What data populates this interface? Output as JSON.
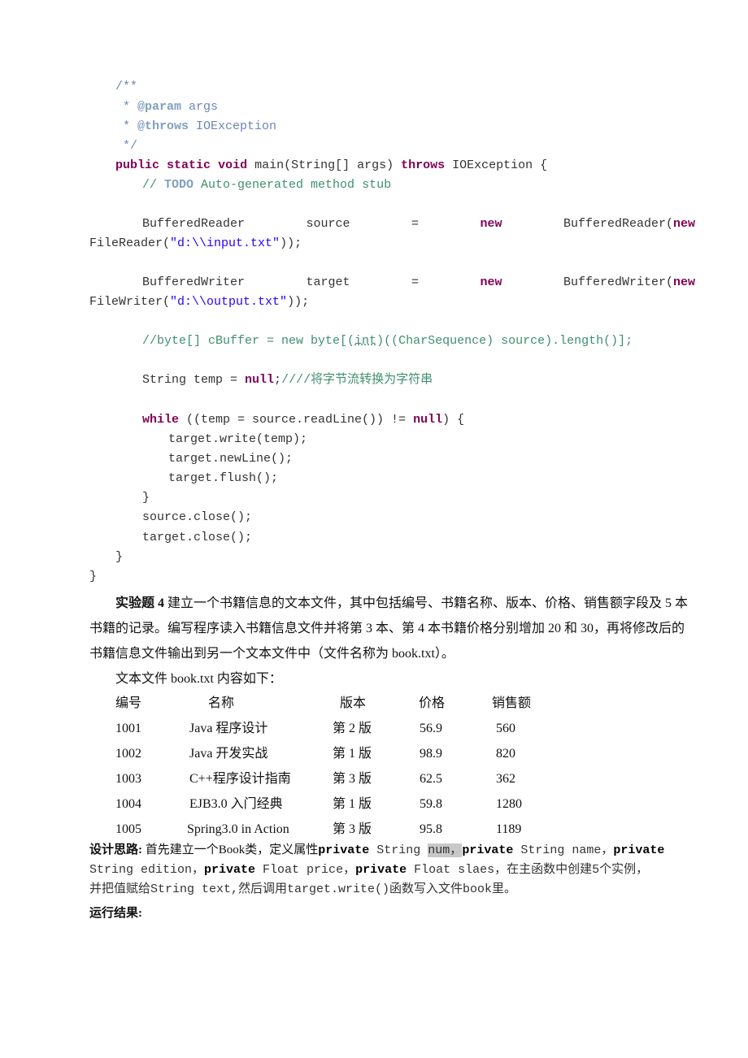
{
  "code": {
    "javadoc": {
      "open": "/**",
      "param_prefix": " * ",
      "param_tag": "@param",
      "param_text": " args",
      "throws_prefix": " * ",
      "throws_tag": "@throws",
      "throws_text": " IOException",
      "close": " */"
    },
    "main_sig": {
      "kw1": "public",
      "kw2": "static",
      "kw3": "void",
      "rest": " main(String[] args) ",
      "kw4": "throws",
      "tail": " IOException {"
    },
    "todo_comment": {
      "prefix": "// ",
      "tag": "TODO",
      "text": " Auto-generated method stub"
    },
    "reader_line": {
      "type": "BufferedReader",
      "var": "source",
      "eq": "=",
      "kw": "new",
      "ctor": "BufferedReader(",
      "kw2": "new",
      "cont_a": "FileReader(",
      "cont_str": "\"d:\\\\input.txt\"",
      "cont_b": "));"
    },
    "writer_line": {
      "type": "BufferedWriter",
      "var": "target",
      "eq": "=",
      "kw": "new",
      "ctor": "BufferedWriter(",
      "kw2": "new",
      "cont_a": "FileWriter(",
      "cont_str": "\"d:\\\\output.txt\"",
      "cont_b": "));"
    },
    "byte_comment": {
      "a": "//byte[] cBuffer = new byte[(",
      "u": "int",
      "b": ")((CharSequence) source).length()];"
    },
    "temp_line": {
      "a": "String temp = ",
      "kw": "null",
      "b": ";",
      "comment": "////将字节流转换为字符串"
    },
    "while_line": {
      "kw": "while",
      "a": " ((temp = source.readLine()) != ",
      "kw2": "null",
      "b": ") {"
    },
    "body_lines": [
      "target.write(temp);",
      "target.newLine();",
      "target.flush();"
    ],
    "close_brace_inner": "}",
    "close_lines": [
      "source.close();",
      "target.close();"
    ],
    "close_brace_method": "}",
    "close_brace_class": "}"
  },
  "exercise": {
    "label": "实验题 4",
    "line1": " 建立一个书籍信息的文本文件，其中包括编号、书籍名称、版本、价格、销售额字段及 5 本",
    "line2": "书籍的记录。编写程序读入书籍信息文件并将第 3 本、第 4 本书籍价格分别增加 20 和 30，再将修改后的",
    "line3": "书籍信息文件输出到另一个文本文件中（文件名称为 book.txt）。",
    "file_intro": "文本文件 book.txt 内容如下："
  },
  "table": {
    "headers": [
      "编号",
      "名称",
      "版本",
      "价格",
      "销售额"
    ],
    "rows": [
      [
        "1001",
        "Java 程序设计",
        "第 2 版",
        "56.9",
        "560"
      ],
      [
        "1002",
        "Java 开发实战",
        "第 1 版",
        "98.9",
        "820"
      ],
      [
        "1003",
        "C++程序设计指南",
        "第 3 版",
        "62.5",
        "362"
      ],
      [
        "1004",
        "EJB3.0 入门经典",
        "第 1 版",
        "59.8",
        "1280"
      ],
      [
        "1005",
        "Spring3.0 in Action",
        "第 3 版",
        "95.8",
        "1189"
      ]
    ]
  },
  "design": {
    "label": "设计思路:",
    "l1_a": " 首先建立一个Book类，定义属性",
    "kw": "private",
    "l1_b": " String ",
    "l1_hl": "num，",
    "l1_c": " String name，",
    "l2_a": "String edition，",
    "l2_b": " Float price，",
    "l2_c": "  Float slaes，在主函数中创建5个实例，",
    "l3": "并把值赋给String text,然后调用target.write()函数写入文件book里。",
    "result_label": "运行结果:"
  }
}
